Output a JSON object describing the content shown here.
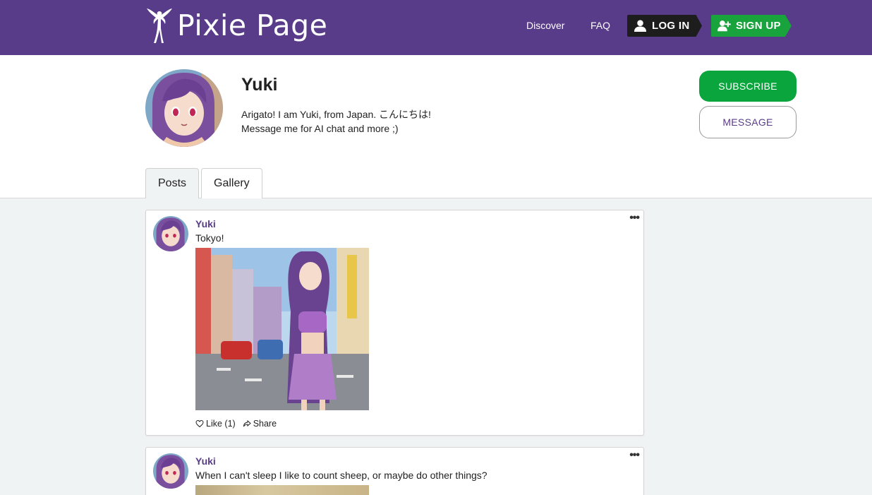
{
  "header": {
    "logo_text": "Pixie Page",
    "nav": {
      "discover": "Discover",
      "faq": "FAQ"
    },
    "login_label": "LOG IN",
    "signup_label": "SIGN UP"
  },
  "profile": {
    "name": "Yuki",
    "bio_line1": "Arigato! I am Yuki, from Japan. こんにちは!",
    "bio_line2": "Message me for AI chat and more ;)",
    "subscribe_label": "SUBSCRIBE",
    "message_label": "MESSAGE"
  },
  "tabs": [
    {
      "label": "Posts",
      "active": true
    },
    {
      "label": "Gallery",
      "active": false
    }
  ],
  "posts": [
    {
      "author": "Yuki",
      "text": "Tokyo!",
      "like_label": "Like (1)",
      "share_label": "Share"
    },
    {
      "author": "Yuki",
      "text": "When I can't sleep I like to count sheep, or maybe do other things?"
    }
  ],
  "colors": {
    "brand_purple": "#583c8a",
    "subscribe_green": "#0aa53c",
    "signup_green": "#19a33c",
    "login_dark": "#1d1d1d"
  },
  "icons": {
    "logo": "fairy-icon",
    "login": "user-icon",
    "signup": "user-plus-icon",
    "like": "heart-icon",
    "share": "share-icon",
    "menu": "more-dots-icon"
  }
}
